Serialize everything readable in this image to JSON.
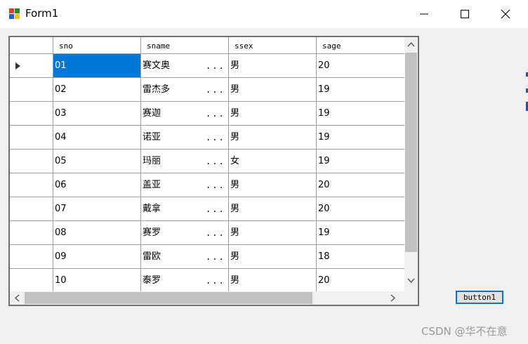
{
  "window": {
    "title": "Form1"
  },
  "grid": {
    "columns": [
      "sno",
      "sname",
      "ssex",
      "sage"
    ],
    "selected_row": 0,
    "rows": [
      {
        "sno": "01",
        "sname": "赛文奥",
        "ssex": "男",
        "sage": "20"
      },
      {
        "sno": "02",
        "sname": "雷杰多",
        "ssex": "男",
        "sage": "19"
      },
      {
        "sno": "03",
        "sname": "赛迦",
        "ssex": "男",
        "sage": "19"
      },
      {
        "sno": "04",
        "sname": "诺亚",
        "ssex": "男",
        "sage": "19"
      },
      {
        "sno": "05",
        "sname": "玛丽",
        "ssex": "女",
        "sage": "19"
      },
      {
        "sno": "06",
        "sname": "盖亚",
        "ssex": "男",
        "sage": "20"
      },
      {
        "sno": "07",
        "sname": "戴拿",
        "ssex": "男",
        "sage": "20"
      },
      {
        "sno": "08",
        "sname": "赛罗",
        "ssex": "男",
        "sage": "19"
      },
      {
        "sno": "09",
        "sname": "雷欧",
        "ssex": "男",
        "sage": "18"
      },
      {
        "sno": "10",
        "sname": "泰罗",
        "ssex": "男",
        "sage": "20"
      }
    ],
    "ellipsis": "...",
    "icons": {
      "row_indicator": "current-row-arrow-icon",
      "scroll_up": "chevron-up-icon",
      "scroll_down": "chevron-down-icon",
      "scroll_left": "chevron-left-icon",
      "scroll_right": "chevron-right-icon"
    }
  },
  "button": {
    "label": "button1"
  },
  "watermark": "CSDN @华不在意",
  "colors": {
    "selection": "#0078d7",
    "button_border": "#0078d7"
  }
}
